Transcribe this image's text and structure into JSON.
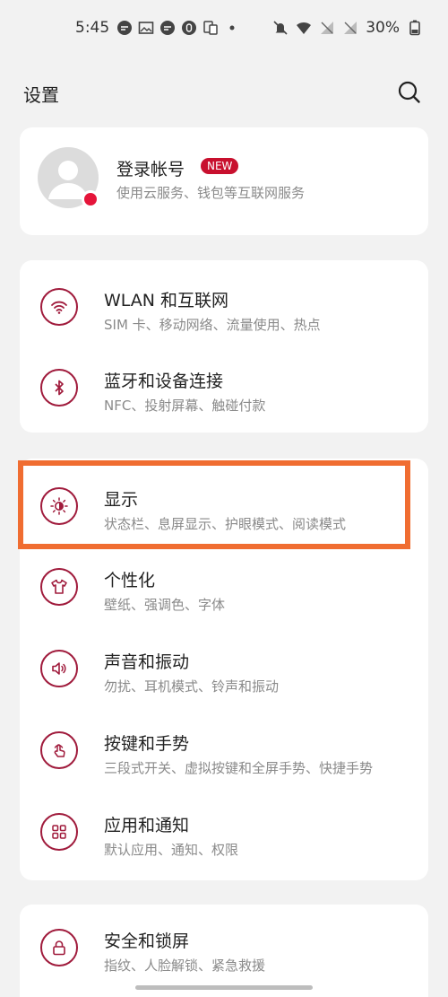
{
  "status_bar": {
    "time": "5:45",
    "battery": "30%"
  },
  "header": {
    "title": "设置"
  },
  "account": {
    "title": "登录帐号",
    "badge": "NEW",
    "subtitle": "使用云服务、钱包等互联网服务"
  },
  "network_items": [
    {
      "title": "WLAN 和互联网",
      "subtitle": "SIM 卡、移动网络、流量使用、热点",
      "icon": "wifi-icon"
    },
    {
      "title": "蓝牙和设备连接",
      "subtitle": "NFC、投射屏幕、触碰付款",
      "icon": "bluetooth-icon"
    }
  ],
  "main_items": [
    {
      "title": "显示",
      "subtitle": "状态栏、息屏显示、护眼模式、阅读模式",
      "icon": "brightness-icon"
    },
    {
      "title": "个性化",
      "subtitle": "壁纸、强调色、字体",
      "icon": "tshirt-icon"
    },
    {
      "title": "声音和振动",
      "subtitle": "勿扰、耳机模式、铃声和振动",
      "icon": "speaker-icon"
    },
    {
      "title": "按键和手势",
      "subtitle": "三段式开关、虚拟按键和全屏手势、快捷手势",
      "icon": "gesture-icon"
    },
    {
      "title": "应用和通知",
      "subtitle": "默认应用、通知、权限",
      "icon": "apps-grid-icon"
    }
  ],
  "security_items": [
    {
      "title": "安全和锁屏",
      "subtitle": "指纹、人脸解锁、紧急救援",
      "icon": "lock-icon"
    }
  ],
  "colors": {
    "accent": "#a01b3c",
    "badge": "#c8102e",
    "highlight": "#f06d31",
    "background": "#f2f2f2"
  }
}
